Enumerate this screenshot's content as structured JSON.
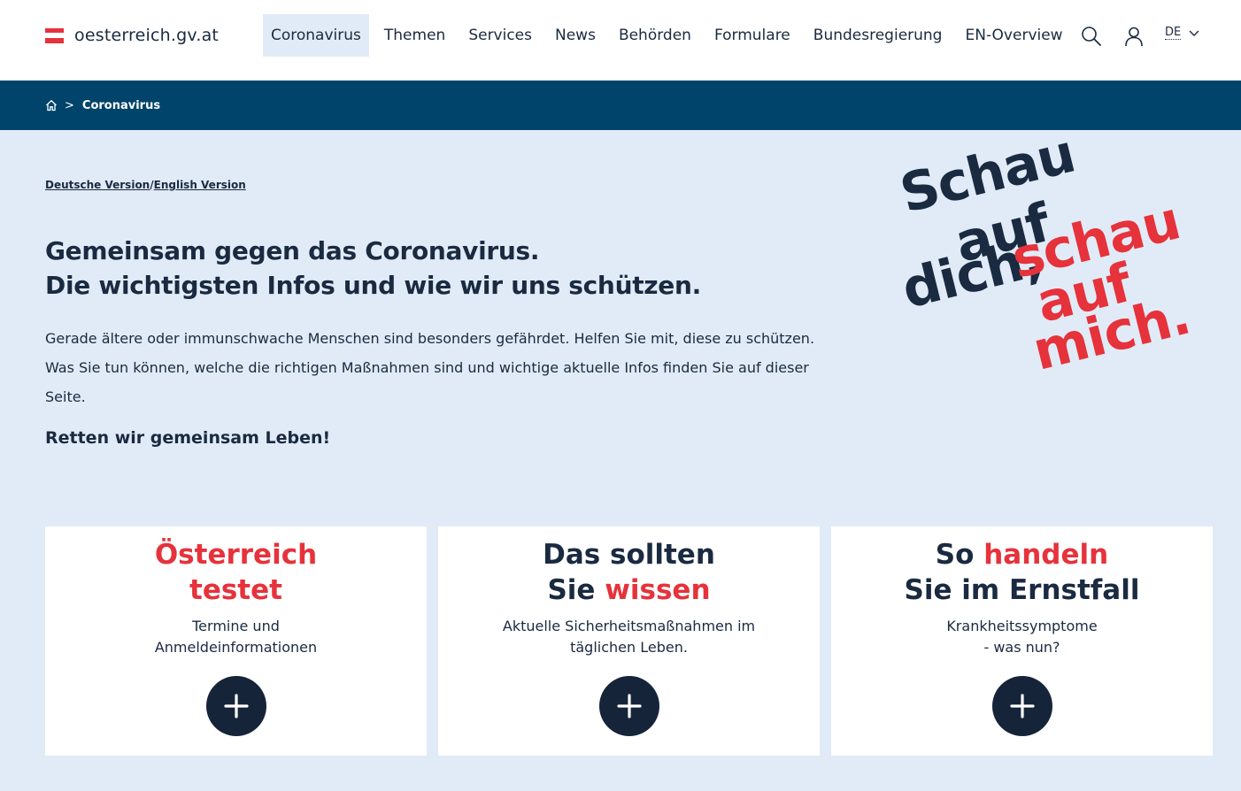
{
  "header": {
    "logo_text": "oesterreich.gv.at",
    "nav": [
      "Coronavirus",
      "Themen",
      "Services",
      "News",
      "Behörden",
      "Formulare",
      "Bundesregierung",
      "EN-Overview"
    ],
    "active_nav": "Coronavirus",
    "language": "DE",
    "icons": [
      "search-icon",
      "user-icon",
      "chevron-down-icon"
    ]
  },
  "breadcrumb": {
    "home_icon": "home-icon",
    "current": "Coronavirus"
  },
  "intro": {
    "german_link": "Deutsche Version",
    "separator": "/",
    "english_link": "English Version",
    "headline_line1": "Gemeinsam gegen das Coronavirus.",
    "headline_line2": "Die wichtigsten Infos und wie wir uns schützen.",
    "lead": "Gerade ältere oder immunschwache Menschen sind besonders gefährdet. Helfen Sie mit, diese zu schützen. Was Sie tun können, welche die richtigen Maßnahmen sind und wichtige aktuelle Infos finden Sie auf dieser Seite.",
    "subhead": "Retten wir gemeinsam Leben!"
  },
  "slogan": {
    "navy_words": [
      "Schau",
      "auf",
      "dich,"
    ],
    "red_words": [
      "schau",
      "auf",
      "mich."
    ]
  },
  "cards": [
    {
      "title_a": "Österreich",
      "title_b": "testet",
      "title_c": "",
      "title_d": "",
      "subtitle_1": "Termine und",
      "subtitle_2": "Anmeldeinformationen"
    },
    {
      "title_a": "Das sollten",
      "title_b": "Sie",
      "title_c": "wissen",
      "title_d": "",
      "subtitle_1": "Aktuelle Sicherheitsmaßnahmen im",
      "subtitle_2": "täglichen Leben."
    },
    {
      "title_a": "So",
      "title_b": "handeln",
      "title_c": "Sie im Ernstfall",
      "title_d": "",
      "subtitle_1": "Krankheitssymptome",
      "subtitle_2": "- was nun?"
    }
  ],
  "colors": {
    "navy": "#1a2a40",
    "red": "#e6323b",
    "breadcrumb_bg": "#00446b",
    "page_bg": "#e1ebf7",
    "plus_button": "#16243a"
  }
}
